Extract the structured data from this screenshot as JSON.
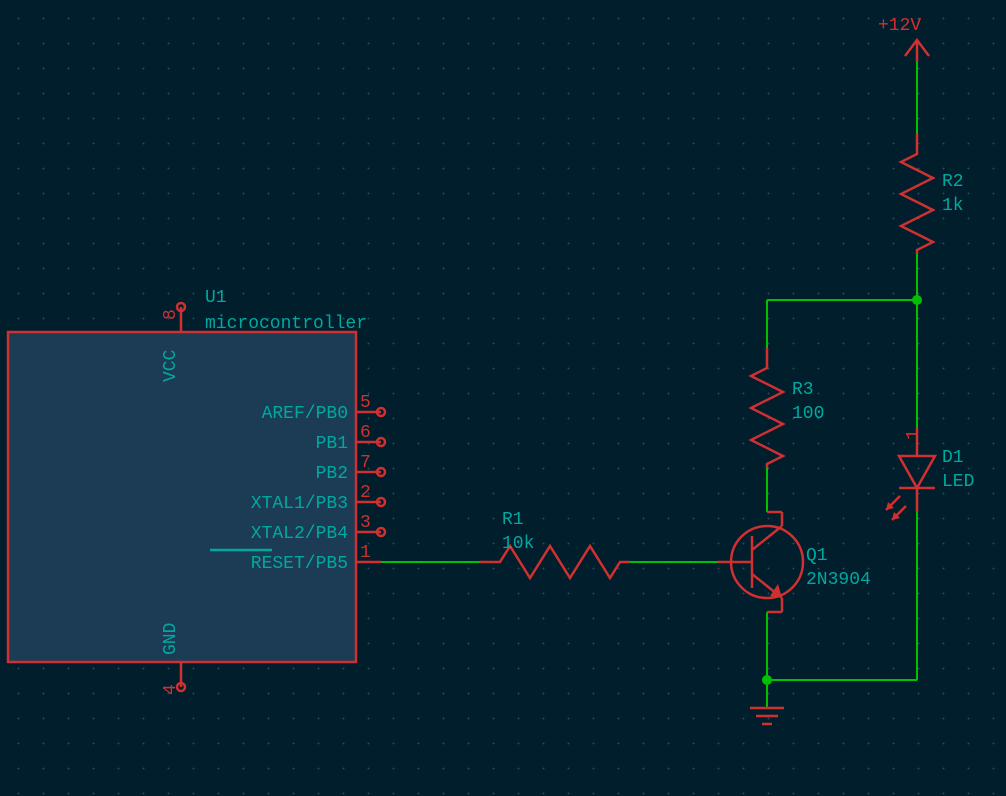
{
  "power": {
    "label": "+12V"
  },
  "U1": {
    "ref": "U1",
    "value": "microcontroller",
    "pins": {
      "vcc": {
        "num": "8",
        "name": "VCC"
      },
      "gnd": {
        "num": "4",
        "name": "GND"
      },
      "pb0": {
        "num": "5",
        "name": "AREF/PB0"
      },
      "pb1": {
        "num": "6",
        "name": "PB1"
      },
      "pb2": {
        "num": "7",
        "name": "PB2"
      },
      "pb3": {
        "num": "2",
        "name": "XTAL1/PB3"
      },
      "pb4": {
        "num": "3",
        "name": "XTAL2/PB4"
      },
      "pb5": {
        "num": "1",
        "name": "RESET/PB5"
      }
    }
  },
  "R1": {
    "ref": "R1",
    "value": "10k"
  },
  "R2": {
    "ref": "R2",
    "value": "1k"
  },
  "R3": {
    "ref": "R3",
    "value": "100"
  },
  "Q1": {
    "ref": "Q1",
    "value": "2N3904"
  },
  "D1": {
    "ref": "D1",
    "value": "LED",
    "pin1": "1"
  }
}
